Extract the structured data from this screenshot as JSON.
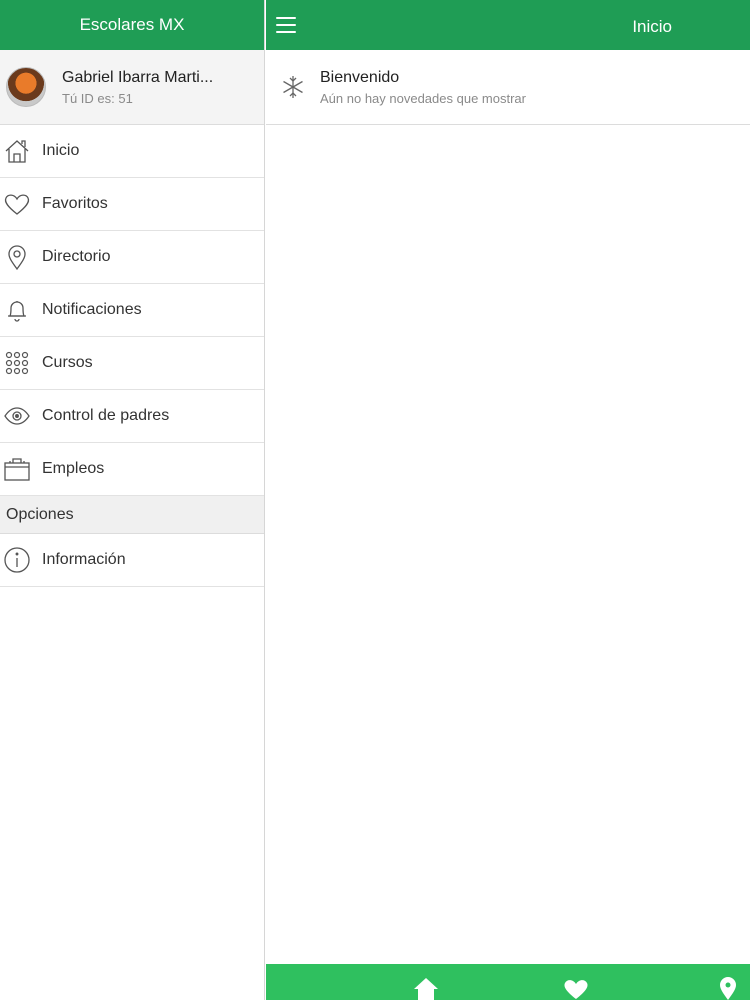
{
  "sidebar": {
    "title": "Escolares MX",
    "profile": {
      "name": "Gabriel Ibarra Marti...",
      "id_text": "Tú ID es: 51"
    },
    "items": [
      {
        "label": "Inicio",
        "icon": "home-icon"
      },
      {
        "label": "Favoritos",
        "icon": "heart-icon"
      },
      {
        "label": "Directorio",
        "icon": "location-pin-icon"
      },
      {
        "label": "Notificaciones",
        "icon": "bell-icon"
      },
      {
        "label": "Cursos",
        "icon": "grid-dots-icon"
      },
      {
        "label": "Control de padres",
        "icon": "eye-icon"
      },
      {
        "label": "Empleos",
        "icon": "briefcase-icon"
      }
    ],
    "section_label": "Opciones",
    "options_items": [
      {
        "label": "Información",
        "icon": "info-icon"
      }
    ]
  },
  "main": {
    "title": "Inicio",
    "notice": {
      "title": "Bienvenido",
      "subtitle": "Aún no hay novedades que mostrar",
      "icon": "asterisk-icon"
    }
  },
  "bottom_tabs": [
    "home-icon",
    "heart-icon",
    "location-pin-icon"
  ],
  "colors": {
    "header_green": "#1f9d55",
    "tabbar_green": "#2fc05f"
  }
}
